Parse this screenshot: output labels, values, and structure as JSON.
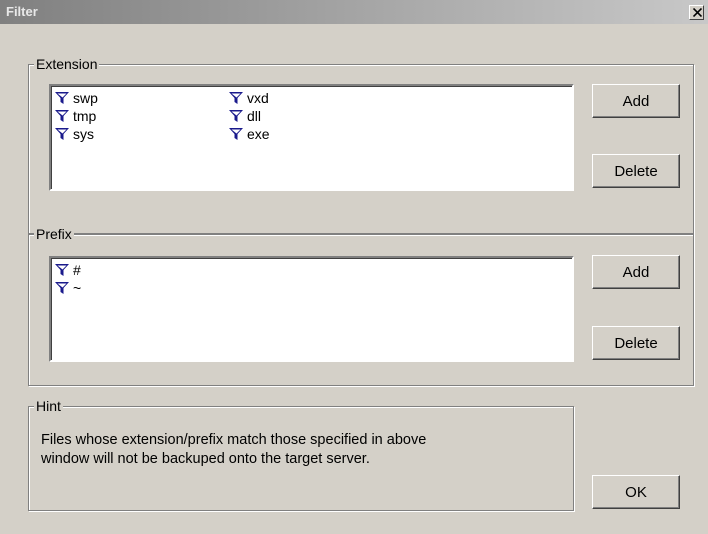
{
  "window": {
    "title": "Filter"
  },
  "extension": {
    "legend": "Extension",
    "items": [
      "swp",
      "tmp",
      "sys",
      "vxd",
      "dll",
      "exe"
    ],
    "add_label": "Add",
    "delete_label": "Delete"
  },
  "prefix": {
    "legend": "Prefix",
    "items": [
      "#",
      "~"
    ],
    "add_label": "Add",
    "delete_label": "Delete"
  },
  "hint": {
    "legend": "Hint",
    "line1": "Files whose extension/prefix match those specified in above",
    "line2": "window will not be backuped onto the target server."
  },
  "ok_label": "OK",
  "icons": {
    "item": "filter-icon",
    "close": "close-icon"
  },
  "colors": {
    "icon_fill": "#1a1a8c",
    "face": "#d4d0c8"
  }
}
